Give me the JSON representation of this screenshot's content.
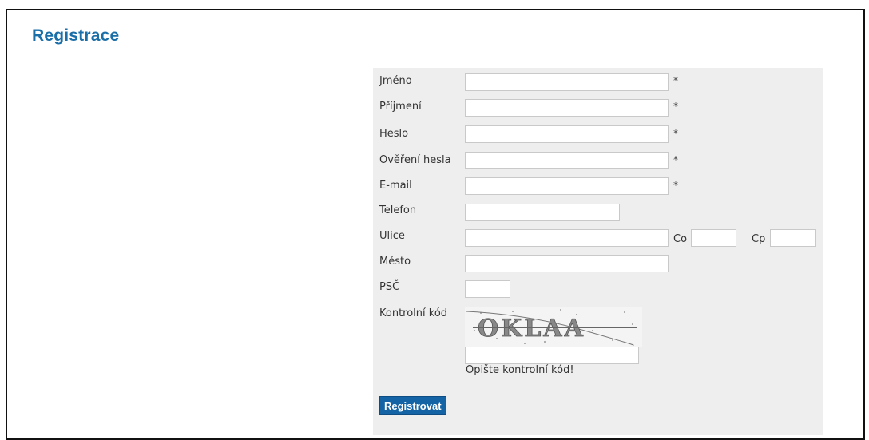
{
  "page": {
    "title": "Registrace"
  },
  "form": {
    "fields": {
      "first_name": {
        "label": "Jméno",
        "value": "",
        "required_mark": "*"
      },
      "last_name": {
        "label": "Příjmení",
        "value": "",
        "required_mark": "*"
      },
      "password": {
        "label": "Heslo",
        "value": "",
        "required_mark": "*"
      },
      "password_confirm": {
        "label": "Ověření hesla",
        "value": "",
        "required_mark": "*"
      },
      "email": {
        "label": "E-mail",
        "value": "",
        "required_mark": "*"
      },
      "phone": {
        "label": "Telefon",
        "value": ""
      },
      "street": {
        "label": "Ulice",
        "value": ""
      },
      "co": {
        "label": "Co",
        "value": ""
      },
      "cp": {
        "label": "Cp",
        "value": ""
      },
      "city": {
        "label": "Město",
        "value": ""
      },
      "zip": {
        "label": "PSČ",
        "value": ""
      },
      "captcha": {
        "label": "Kontrolní kód",
        "image_text": "OKLAA",
        "value": "",
        "hint": "Opište kontrolní kód!"
      }
    },
    "submit_label": "Registrovat"
  },
  "colors": {
    "title": "#1b6fa8",
    "panel_bg": "#eeeeee",
    "button_bg": "#1464a5"
  }
}
